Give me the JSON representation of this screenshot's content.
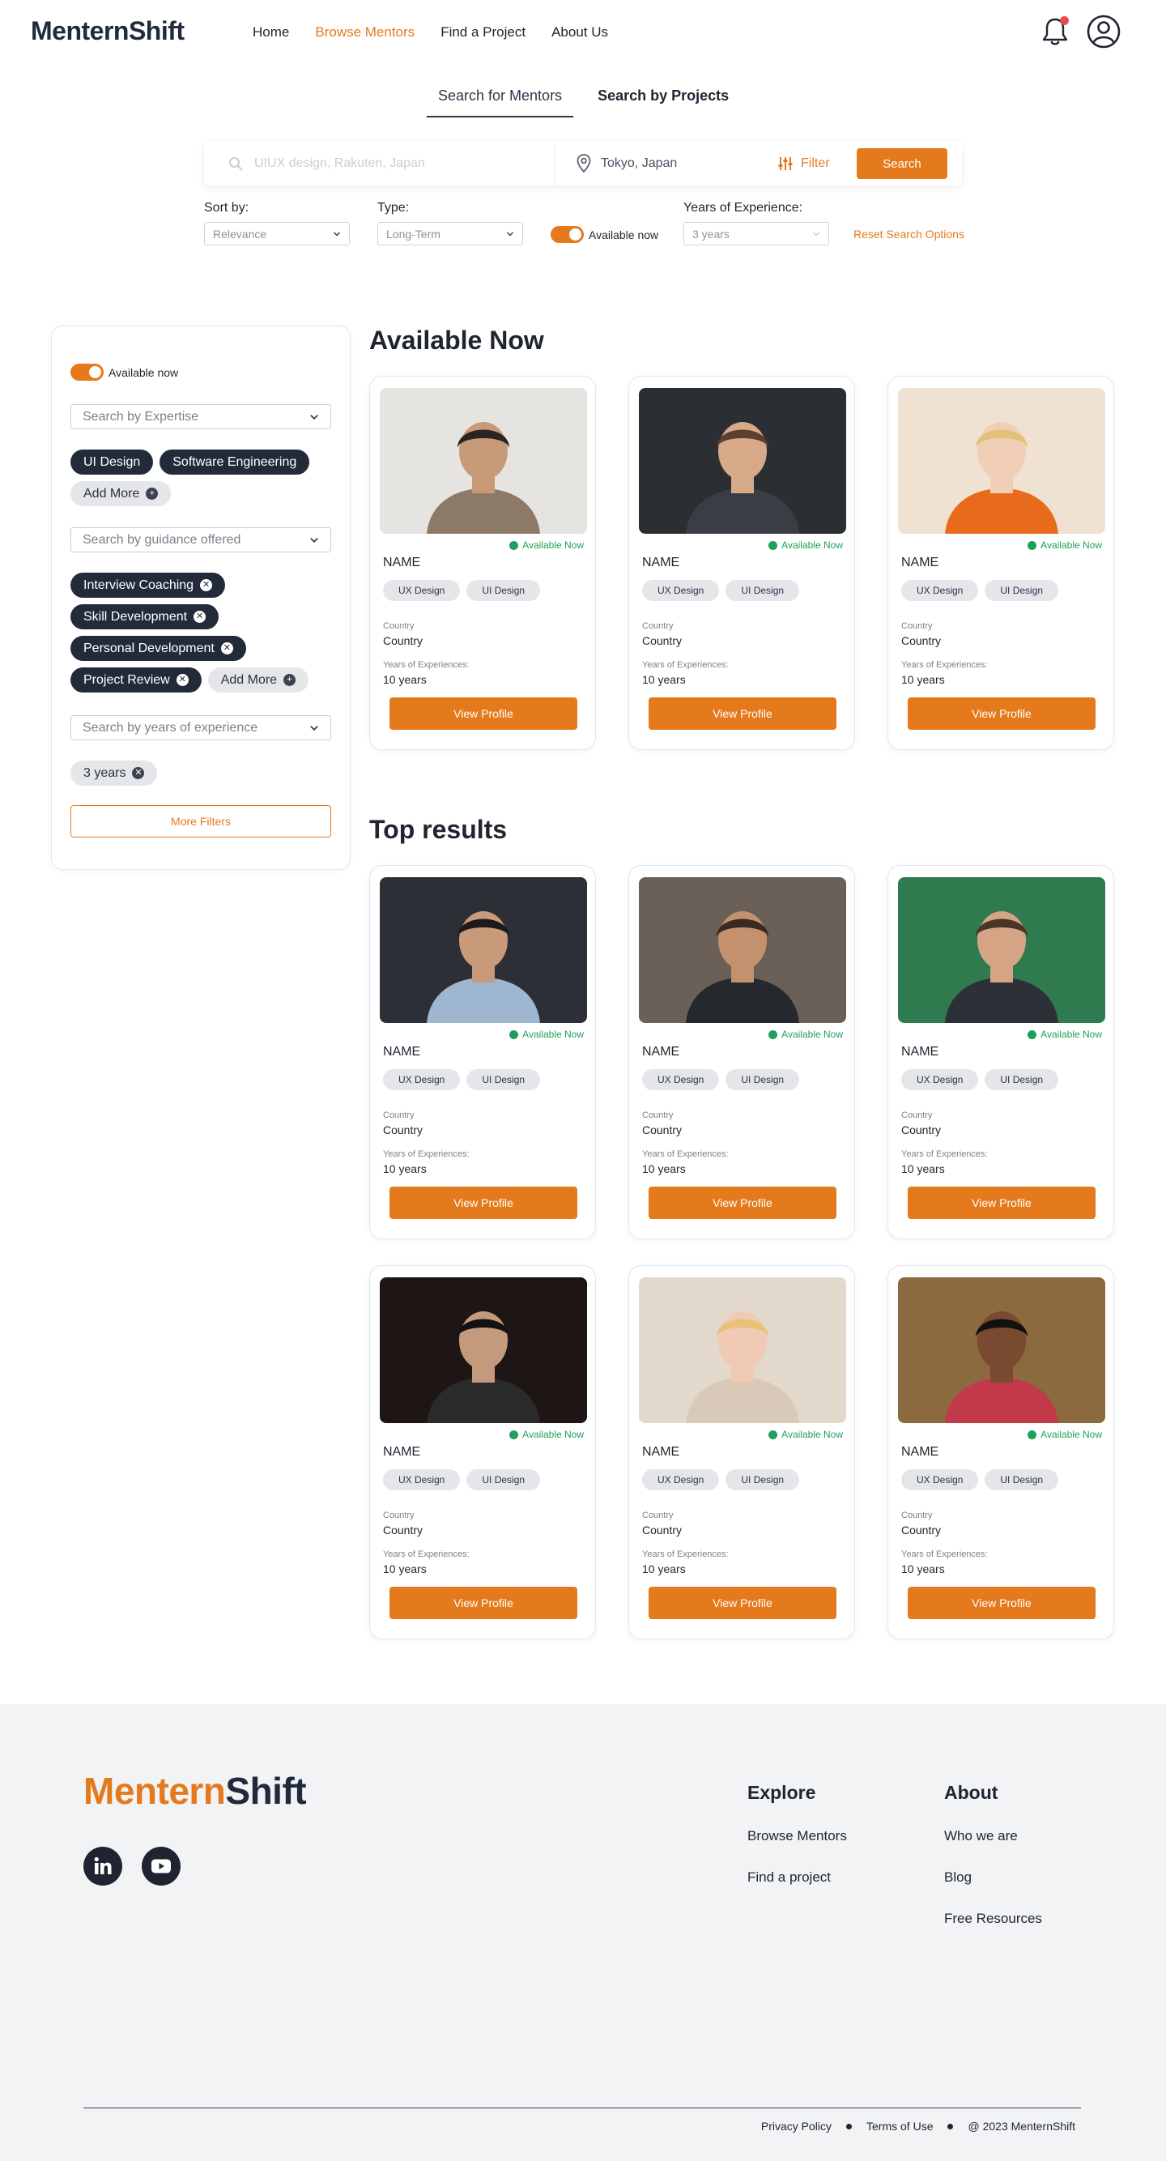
{
  "header": {
    "logo": "MenternShift",
    "nav": [
      "Home",
      "Browse Mentors",
      "Find a Project",
      "About Us"
    ],
    "active_nav": "Browse Mentors"
  },
  "search": {
    "tabs": [
      "Search for Mentors",
      "Search by Projects"
    ],
    "active_tab": "Search for Mentors",
    "query_placeholder": "UIUX design, Rakuten, Japan",
    "location": "Tokyo, Japan",
    "filter_label": "Filter",
    "search_label": "Search"
  },
  "sort": {
    "sort_by_label": "Sort by:",
    "sort_by_value": "Relevance",
    "type_label": "Type:",
    "type_value": "Long-Term",
    "available_label": "Available now",
    "experience_label": "Years of Experience:",
    "experience_value": "3 years",
    "reset_label": "Reset Search Options"
  },
  "sidebar": {
    "available_label": "Available now",
    "expertise_placeholder": "Search by Expertise",
    "expertise_chips": [
      "UI Design",
      "Software Engineering"
    ],
    "expertise_add": "Add More",
    "guidance_placeholder": "Search by guidance offered",
    "guidance_chips": [
      "Interview Coaching",
      "Skill Development",
      "Personal Development",
      "Project Review"
    ],
    "guidance_add": "Add More",
    "experience_placeholder": "Search by years of experience",
    "experience_chip": "3 years",
    "more_filters": "More Filters"
  },
  "sections": {
    "available_title": "Available Now",
    "top_title": "Top results"
  },
  "card_template": {
    "available": "Available Now",
    "name": "NAME",
    "tags": [
      "UX Design",
      "UI Design"
    ],
    "country_label": "Country",
    "country_value": "Country",
    "exp_label": "Years of Experiences:",
    "exp_value": "10 years",
    "button": "View Profile"
  },
  "footer": {
    "logo_part1": "Mentern",
    "logo_part2": "Shift",
    "social_icons": [
      "linkedin-icon",
      "youtube-icon"
    ],
    "explore_title": "Explore",
    "explore_links": [
      "Browse Mentors",
      "Find a project"
    ],
    "about_title": "About",
    "about_links": [
      "Who we are",
      "Blog",
      "Free Resources"
    ],
    "bottom_links": [
      "Privacy Policy",
      "Terms of Use",
      "@ 2023 MenternShift"
    ]
  },
  "colors": {
    "accent": "#e57a1c",
    "dark": "#232b3b",
    "available_green": "#1fa05a"
  }
}
